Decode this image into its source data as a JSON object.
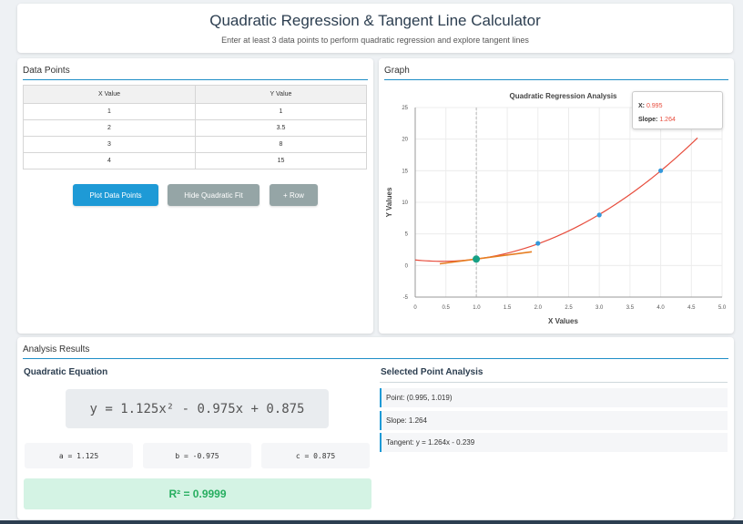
{
  "header": {
    "title": "Quadratic Regression & Tangent Line Calculator",
    "subtitle": "Enter at least 3 data points to perform quadratic regression and explore tangent lines"
  },
  "data_panel": {
    "title": "Data Points",
    "columns": [
      "X Value",
      "Y Value"
    ],
    "rows": [
      [
        "1",
        "1"
      ],
      [
        "2",
        "3.5"
      ],
      [
        "3",
        "8"
      ],
      [
        "4",
        "15"
      ]
    ],
    "buttons": {
      "plot": "Plot Data Points",
      "hide_fit": "Hide Quadratic Fit",
      "add_row": "+ Row"
    }
  },
  "graph_panel": {
    "title": "Graph",
    "tooltip": {
      "x_label": "X:",
      "x_value": "0.995",
      "slope_label": "Slope:",
      "slope_value": "1.264"
    }
  },
  "chart_data": {
    "type": "scatter",
    "title": "Quadratic Regression Analysis",
    "xlabel": "X Values",
    "ylabel": "Y Values",
    "xlim": [
      0,
      5
    ],
    "ylim": [
      -5,
      25
    ],
    "x_ticks": [
      "0",
      "0.5",
      "1.0",
      "1.5",
      "2.0",
      "2.5",
      "3.0",
      "3.5",
      "4.0",
      "4.5",
      "5.0"
    ],
    "y_ticks": [
      "-5",
      "0",
      "5",
      "10",
      "15",
      "20",
      "25"
    ],
    "grid": true,
    "series": [
      {
        "points": [
          [
            1,
            1
          ],
          [
            2,
            3.5
          ],
          [
            3,
            8
          ],
          [
            4,
            15
          ]
        ],
        "color": "#3498db"
      },
      {
        "fit": {
          "a": 1.125,
          "b": -0.975,
          "c": 0.875
        },
        "x_range": [
          0,
          4.6
        ],
        "color": "#e74c3c"
      },
      {
        "tangent": {
          "x0": 0.995,
          "y0": 1.019,
          "slope": 1.264
        },
        "x_range": [
          0.4,
          1.9
        ],
        "color": "#e67e22"
      }
    ],
    "selected_point": {
      "x": 0.995,
      "y": 1.019,
      "color": "#16a085"
    },
    "colors": {
      "grid": "#ececec",
      "axis": "#999999",
      "guide": "#aaaaaa"
    }
  },
  "results": {
    "title": "Analysis Results",
    "equation_heading": "Quadratic Equation",
    "equation": "y = 1.125x² - 0.975x + 0.875",
    "coefficients": {
      "a": "a = 1.125",
      "b": "b = -0.975",
      "c": "c = 0.875"
    },
    "r2": "R² = 0.9999",
    "point_heading": "Selected Point Analysis",
    "point": "Point: (0.995, 1.019)",
    "slope": "Slope: 1.264",
    "tangent": "Tangent: y = 1.264x - 0.239"
  }
}
